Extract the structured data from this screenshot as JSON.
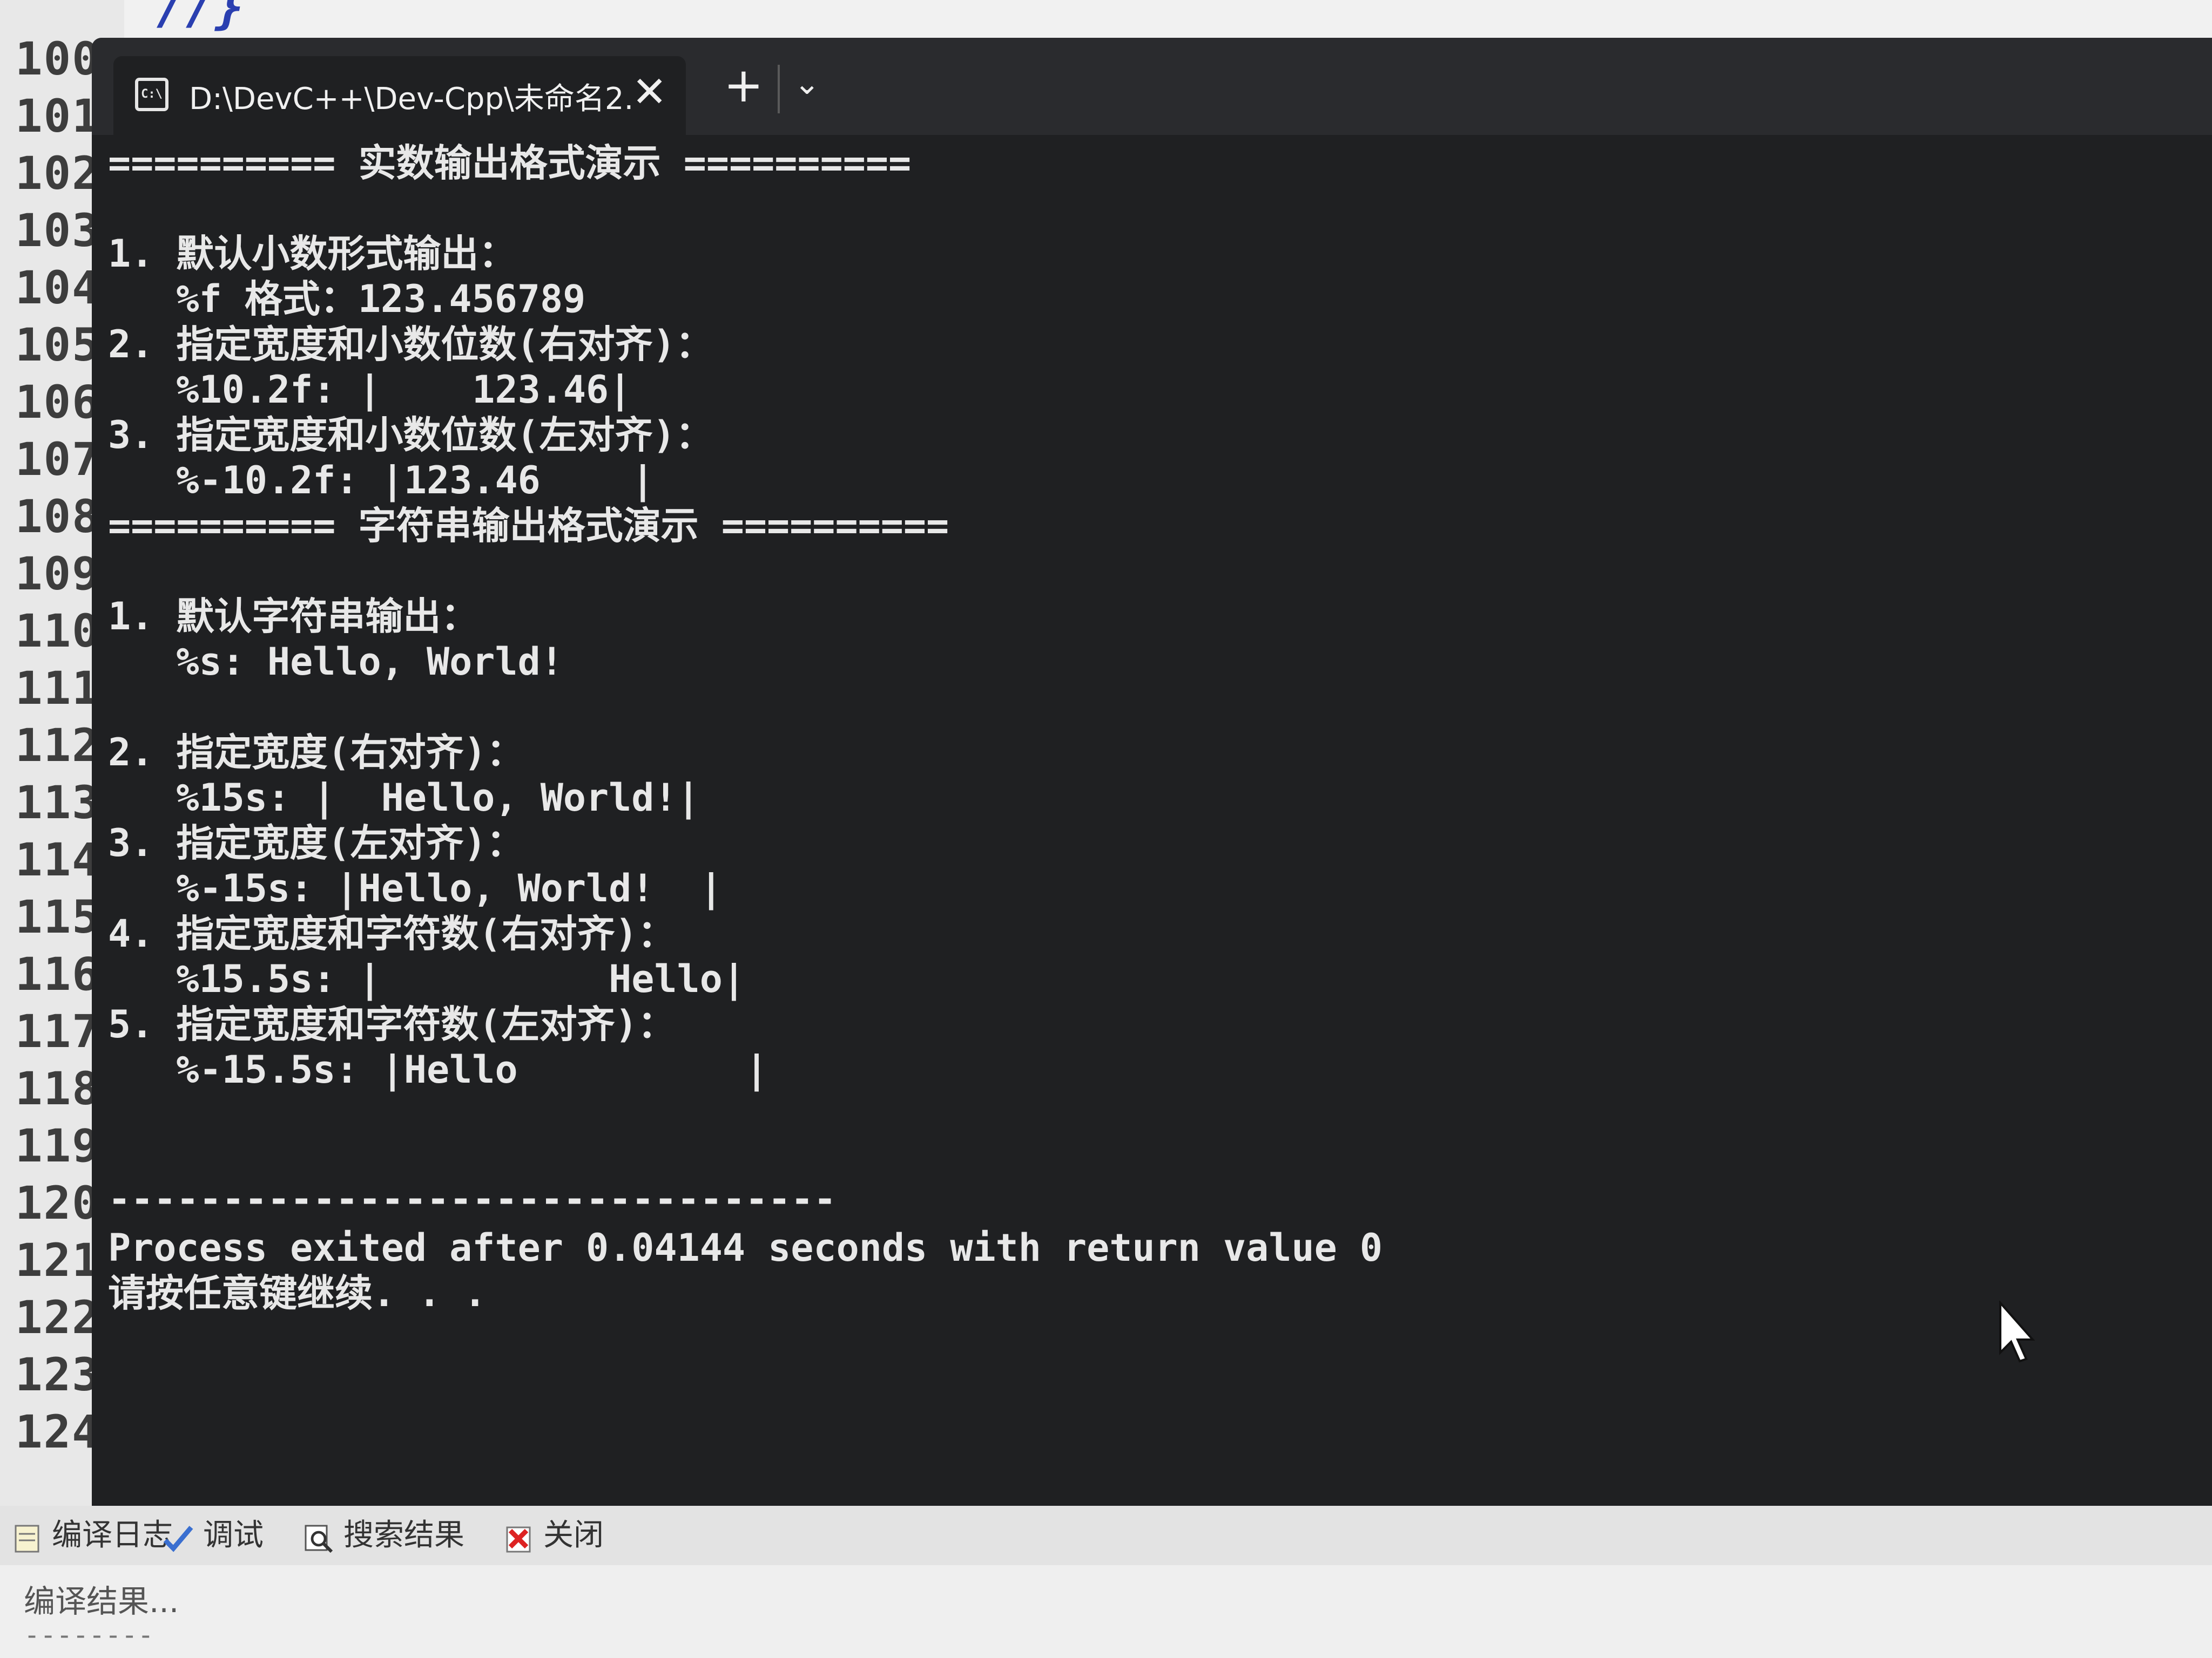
{
  "editor": {
    "code_fragment": "//}",
    "line_numbers": [
      "100",
      "101",
      "102",
      "103",
      "104",
      "105",
      "106",
      "107",
      "108",
      "109",
      "110",
      "111",
      "112",
      "113",
      "114",
      "115",
      "116",
      "117",
      "118",
      "119",
      "120",
      "121",
      "122",
      "123",
      "124"
    ]
  },
  "console": {
    "tab_title": "D:\\DevC++\\Dev-Cpp\\未命名2.",
    "tab_icon": "console-icon",
    "close_glyph": "✕",
    "new_tab_glyph": "+",
    "dropdown_glyph": "⌄",
    "lines": [
      "========== 实数输出格式演示 ==========",
      "",
      "1. 默认小数形式输出：",
      "   %f 格式：123.456789",
      "2. 指定宽度和小数位数(右对齐)：",
      "   %10.2f: |    123.46|",
      "3. 指定宽度和小数位数(左对齐)：",
      "   %-10.2f: |123.46    |",
      "========== 字符串输出格式演示 ==========",
      "",
      "1. 默认字符串输出：",
      "   %s: Hello, World!",
      "",
      "2. 指定宽度(右对齐)：",
      "   %15s: |  Hello, World!|",
      "3. 指定宽度(左对齐)：",
      "   %-15s: |Hello, World!  |",
      "4. 指定宽度和字符数(右对齐)：",
      "   %15.5s: |          Hello|",
      "5. 指定宽度和字符数(左对齐)：",
      "   %-15.5s: |Hello          |",
      "",
      "--------------------------------",
      "Process exited after 0.04144 seconds with return value 0",
      "请按任意键继续. . ."
    ]
  },
  "bottom_panel": {
    "tabs": [
      {
        "label": "编译日志",
        "icon": "compile-log-icon"
      },
      {
        "label": "调试",
        "icon": "checkmark-icon"
      },
      {
        "label": "搜索结果",
        "icon": "search-icon"
      },
      {
        "label": "关闭",
        "icon": "close-icon"
      }
    ],
    "compile_result": "编译结果...",
    "dashes": "--------"
  },
  "colors": {
    "console_bg": "#1f2022",
    "console_text": "#e8e8e8",
    "titlebar_bg": "#2a2b2e",
    "code_blue": "#2a3fb0"
  }
}
